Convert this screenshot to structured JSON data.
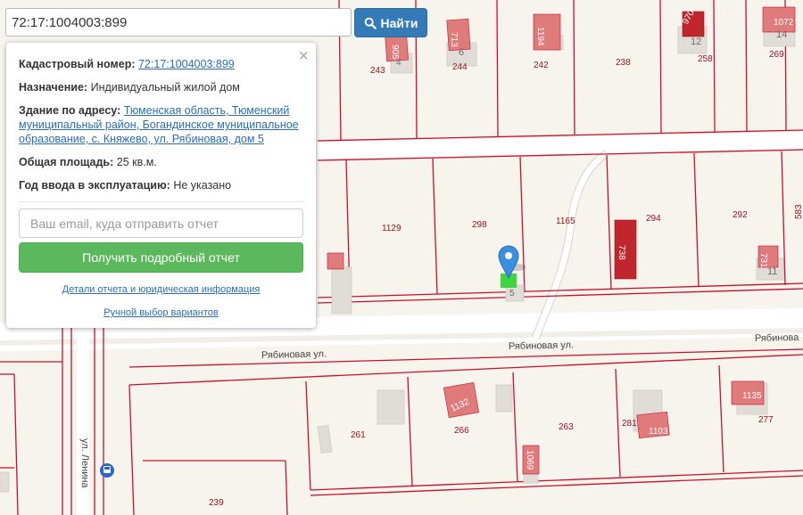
{
  "search": {
    "value": "72:17:1004003:899",
    "button_label": "Найти"
  },
  "popup": {
    "cadastral_label": "Кадастровый номер:",
    "cadastral_value": "72:17:1004003:899",
    "purpose_label": "Назначение:",
    "purpose_value": "Индивидуальный жилой дом",
    "address_label": "Здание по адресу:",
    "address_value": "Тюменская область, Тюменский муниципальный район, Богандинское муниципальное образование, с. Княжево, ул. Рябиновая, дом 5",
    "area_label": "Общая площадь:",
    "area_value": "25 кв.м.",
    "year_label": "Год ввода в эксплуатацию:",
    "year_value": "Не указано",
    "email_placeholder": "Ваш email, куда отправить отчет",
    "report_button": "Получить подробный отчет",
    "details_link": "Детали отчета и юридическая информация",
    "manual_link": "Ручной выбор вариантов",
    "close_glyph": "×"
  },
  "map": {
    "parcel_labels": [
      "243",
      "244",
      "242",
      "238",
      "258",
      "269",
      "1129",
      "298",
      "1165",
      "294",
      "292",
      "583",
      "261",
      "266",
      "263",
      "281",
      "277",
      "239"
    ],
    "building_labels": [
      "6",
      "4",
      "12",
      "14",
      "11",
      "5",
      "905",
      "713",
      "1194",
      "970",
      "1072",
      "738",
      "731",
      "1132",
      "1069",
      "1103",
      "1135"
    ],
    "street_labels": [
      "Рябиновая ул.",
      "Рябиновая ул.",
      "Рябинова",
      "ул. Ленина"
    ],
    "colors": {
      "background": "#f7f4ee",
      "parcel_border": "#c8102e",
      "road": "#ffffff",
      "building_fill": "#e07b7b",
      "building_dark": "#c0262b",
      "house_grey": "#e0ddd8",
      "selected_building": "#3ed63e",
      "marker": "#3b8ee0"
    },
    "icons": [
      "map-marker-icon",
      "bus-stop-icon",
      "search-icon",
      "close-icon"
    ]
  }
}
